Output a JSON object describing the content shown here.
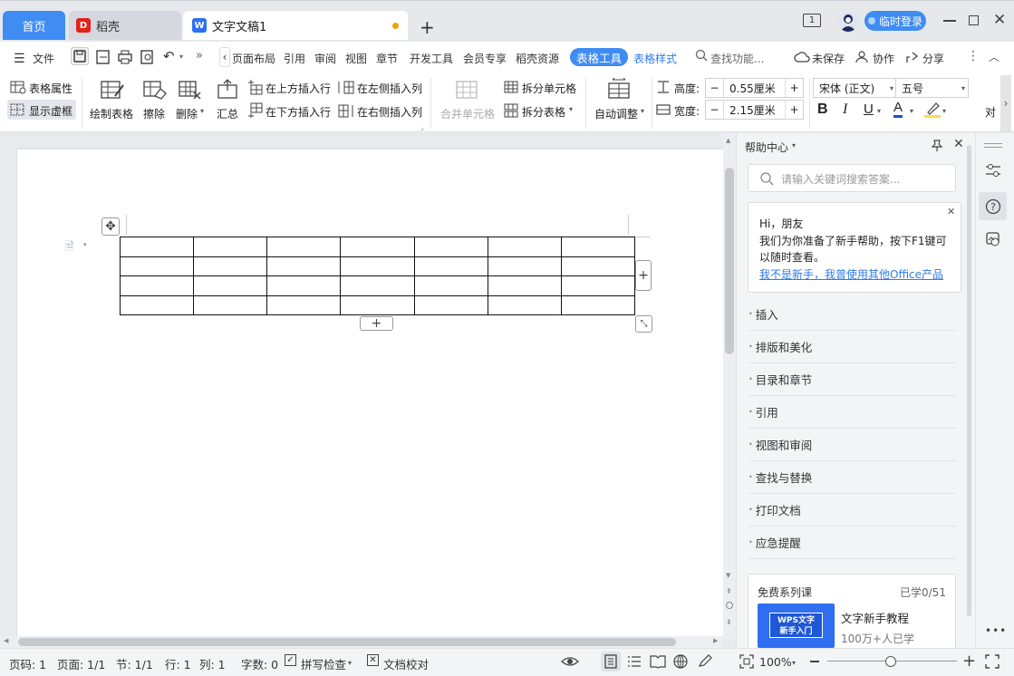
{
  "tabs": {
    "home": "首页",
    "daoke": "稻壳",
    "doc": "文字文稿1",
    "window_box": "1"
  },
  "account": {
    "login": "临时登录"
  },
  "menu": {
    "file": "文件",
    "items": [
      "页面布局",
      "引用",
      "审阅",
      "视图",
      "章节",
      "开发工具",
      "会员专享",
      "稻壳资源"
    ],
    "table_tools": "表格工具",
    "table_style": "表格样式",
    "search": "查找功能...",
    "unsaved": "未保存",
    "collab": "协作",
    "share": "分享"
  },
  "ribbon": {
    "table_props": "表格属性",
    "show_grid": "显示虚框",
    "draw_table": "绘制表格",
    "erase": "擦除",
    "delete": "删除",
    "summary": "汇总",
    "insert_above": "在上方插入行",
    "insert_below": "在下方插入行",
    "insert_left": "在左侧插入列",
    "insert_right": "在右侧插入列",
    "merge_cells": "合并单元格",
    "split_cells": "拆分单元格",
    "split_table": "拆分表格",
    "auto_adjust": "自动调整",
    "height_label": "高度:",
    "height_value": "0.55厘米",
    "width_label": "宽度:",
    "width_value": "2.15厘米",
    "font_name": "宋体 (正文)",
    "font_size": "五号",
    "align": "对"
  },
  "document": {
    "table": {
      "rows": 4,
      "cols": 7
    }
  },
  "help": {
    "title": "帮助中心",
    "search_placeholder": "请输入关键词搜索答案...",
    "greeting": "Hi，朋友",
    "greeting_body": "我们为你准备了新手帮助，按下F1键可以随时查看。",
    "office_link": "我不是新手，我曾使用其他Office产品",
    "topics": [
      "插入",
      "排版和美化",
      "目录和章节",
      "引用",
      "视图和审阅",
      "查找与替换",
      "打印文档",
      "应急提醒"
    ],
    "course_title": "免费系列课",
    "course_progress": "已学0/51",
    "course_thumb_line1": "WPS文字",
    "course_thumb_line2": "新手入门",
    "course_name": "文字新手教程",
    "course_learners": "100万+人已学"
  },
  "status": {
    "page": "页码: 1",
    "pages": "页面: 1/1",
    "section": "节: 1/1",
    "row": "行: 1",
    "col": "列: 1",
    "words": "字数: 0",
    "spell": "拼写检查",
    "proof": "文档校对",
    "zoom": "100%"
  },
  "colors": {
    "accent": "#3f8cf2",
    "font_color": "#1a4fd6",
    "highlight": "#f5e04a"
  }
}
